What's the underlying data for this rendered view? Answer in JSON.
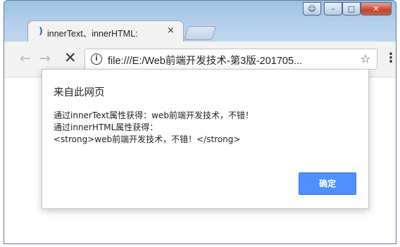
{
  "window": {
    "controls": {
      "user_icon": "user-icon",
      "minimize": "–",
      "maximize": "□",
      "close": "✕"
    }
  },
  "tab": {
    "title": "innerText、innerHTML:",
    "close": "×"
  },
  "toolbar": {
    "back": "←",
    "forward": "→",
    "stop": "✕",
    "url_icon": "i",
    "url": "file:///E:/Web前端开发技术-第3版-201705...",
    "star": "☆",
    "menu": "⋮"
  },
  "dialog": {
    "title": "来自此网页",
    "lines": [
      "通过innerText属性获得：web前端开发技术，不错！",
      "通过innerHTML属性获得：",
      "<strong>web前端开发技术，不错！</strong>"
    ],
    "ok_label": "确定"
  },
  "colors": {
    "accent": "#4d90fe",
    "chrome_frame": "#b9d3ee",
    "toolbar": "#f2f2f2"
  }
}
